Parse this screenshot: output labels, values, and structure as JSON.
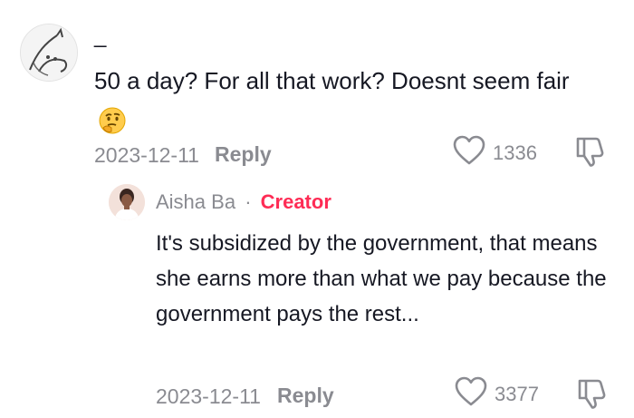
{
  "top_comment": {
    "username": "_",
    "text": "50 a day? For all that work? Doesnt seem fair",
    "emoji": "thinking-face",
    "date": "2023-12-11",
    "reply_label": "Reply",
    "like_count": "1336"
  },
  "reply_comment": {
    "username": "Aisha Ba",
    "separator": "·",
    "creator_label": "Creator",
    "text": "It's subsidized by the government, that means she earns more than what we pay because the government pays the rest...",
    "date": "2023-12-11",
    "reply_label": "Reply",
    "like_count": "3377"
  },
  "colors": {
    "text_primary": "#161823",
    "text_secondary": "#8a8b91",
    "creator_accent": "#fe2c55"
  },
  "icons": [
    "heart-icon",
    "dislike-icon",
    "thinking-face-emoji"
  ]
}
